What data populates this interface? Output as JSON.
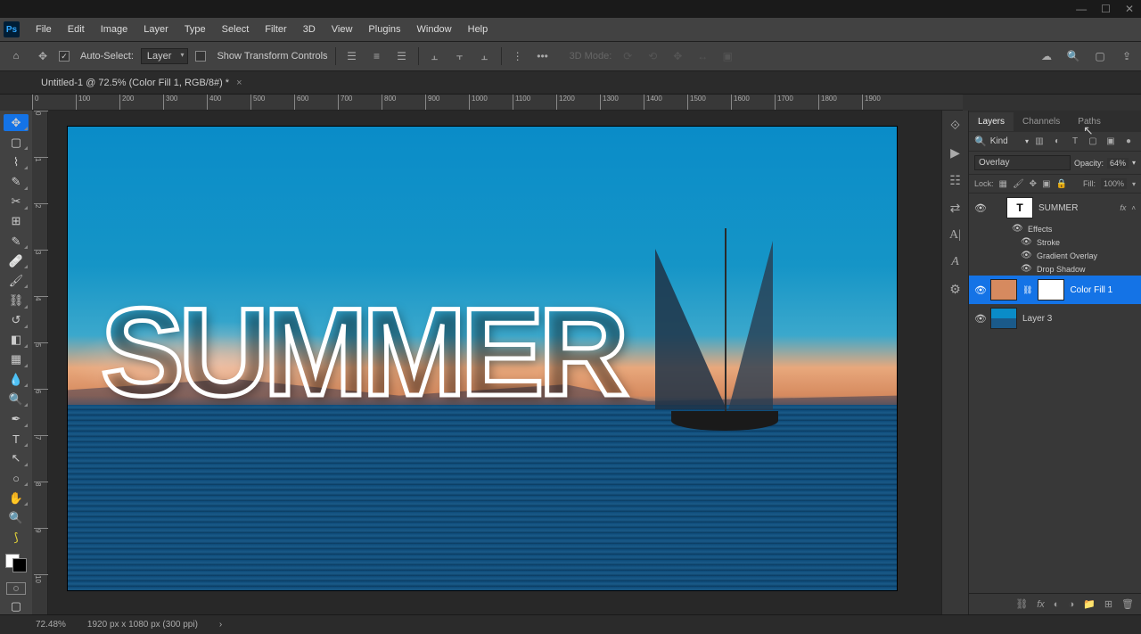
{
  "menubar": [
    "File",
    "Edit",
    "Image",
    "Layer",
    "Type",
    "Select",
    "Filter",
    "3D",
    "View",
    "Plugins",
    "Window",
    "Help"
  ],
  "options": {
    "auto_select": "Auto-Select:",
    "target": "Layer",
    "show_transform": "Show Transform Controls",
    "mode3d": "3D Mode:"
  },
  "doctab": {
    "title": "Untitled-1 @ 72.5% (Color Fill 1, RGB/8#) *"
  },
  "ruler_h": [
    "0",
    "100",
    "200",
    "300",
    "400",
    "500",
    "600",
    "700",
    "800",
    "900",
    "1000",
    "1100",
    "1200",
    "1300",
    "1400",
    "1500",
    "1600",
    "1700",
    "1800",
    "1900"
  ],
  "ruler_v": [
    "0",
    "1",
    "2",
    "3",
    "4",
    "5",
    "6",
    "7",
    "8",
    "9",
    "10"
  ],
  "canvas_text": "SUMMER",
  "panels": {
    "tabs": [
      "Layers",
      "Channels",
      "Paths"
    ],
    "filter_kind": "Kind",
    "blend_mode": "Overlay",
    "opacity_label": "Opacity:",
    "opacity_value": "64%",
    "lock_label": "Lock:",
    "fill_label": "Fill:",
    "fill_value": "100%",
    "layers": {
      "summer": "SUMMER",
      "effects": "Effects",
      "stroke": "Stroke",
      "gradient": "Gradient Overlay",
      "dropshadow": "Drop Shadow",
      "colorfill": "Color Fill 1",
      "layer3": "Layer 3",
      "fx": "fx"
    }
  },
  "status": {
    "zoom": "72.48%",
    "dims": "1920 px x 1080 px (300 ppi)"
  }
}
